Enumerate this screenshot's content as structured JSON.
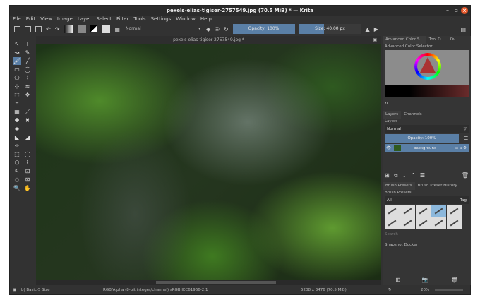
{
  "title": "pexels-elias-tigiser-2757549.jpg (70.5 MiB)  * — Krita",
  "menu": [
    "File",
    "Edit",
    "View",
    "Image",
    "Layer",
    "Select",
    "Filter",
    "Tools",
    "Settings",
    "Window",
    "Help"
  ],
  "toolbar": {
    "blend_mode": "Normal",
    "opacity": "Opacity: 100%",
    "size": "Size: 40.00 px"
  },
  "document_tab": "pexels-elias-tigiser-2757549.jpg *",
  "toolbox": [
    "↖",
    "T",
    "↝",
    "✎",
    "🖌",
    "╱",
    "▭",
    "◯",
    "⬠",
    "⌇",
    "⊹",
    "≈",
    "⬚",
    "✥",
    "⌗",
    "",
    "▦",
    "⟋",
    "✚",
    "✖",
    "◈",
    "",
    "◣",
    "◢",
    "✑",
    "",
    "⬚",
    "◯",
    "⬠",
    "⌇",
    "↖",
    "⊡",
    "◌",
    "⊠",
    "🔍",
    "✋"
  ],
  "docker": {
    "tabs": [
      "Advanced Color S...",
      "Tool O...",
      "Ov..."
    ],
    "color_selector_title": "Advanced Color Selector",
    "layer_tabs": [
      "Layers",
      "Channels"
    ],
    "layers_title": "Layers",
    "layer_blend": "Normal",
    "layer_opacity": "Opacity:  100%",
    "layers": [
      {
        "name": "background"
      }
    ],
    "brush_tabs": [
      "Brush Presets",
      "Brush Preset History"
    ],
    "brush_title": "Brush Presets",
    "brush_filter": "All",
    "tag_label": "Tag",
    "search_placeholder": "Search",
    "snapshot_title": "Snapshot Docker"
  },
  "status": {
    "brush": "b) Basic-5 Size",
    "color_space": "RGB/Alpha (8-bit integer/channel)  sRGB IEC61966-2.1",
    "dimensions": "5208 x 3476 (70.5 MiB)",
    "zoom": "20%"
  }
}
